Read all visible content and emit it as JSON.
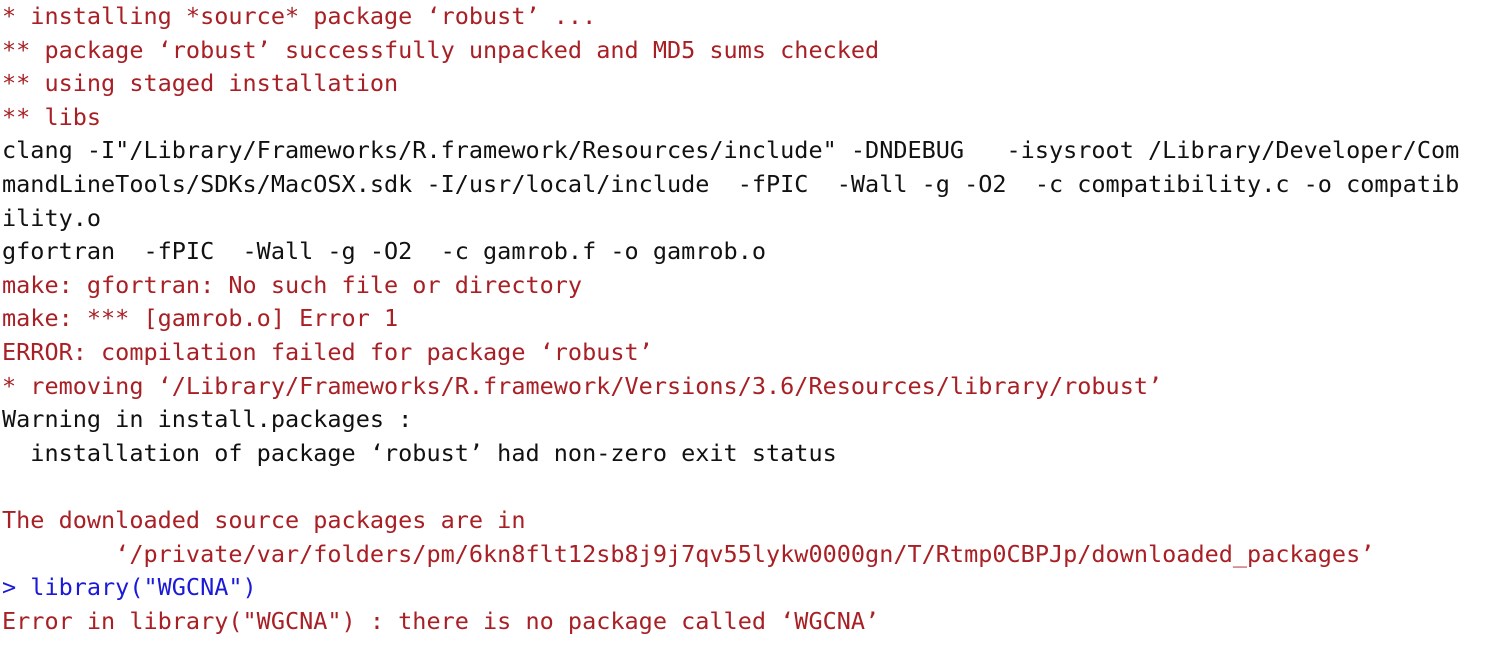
{
  "window": {
    "app": "R Console",
    "background": "#ffffff"
  },
  "colors": {
    "error": "#a82025",
    "stdout": "#111111",
    "prompt": "#1a1ad8"
  },
  "console": {
    "lines": [
      {
        "text": "* installing *source* package ‘robust’ ...",
        "stream": "error"
      },
      {
        "text": "** package ‘robust’ successfully unpacked and MD5 sums checked",
        "stream": "error"
      },
      {
        "text": "** using staged installation",
        "stream": "error"
      },
      {
        "text": "** libs",
        "stream": "error"
      },
      {
        "text": "clang -I\"/Library/Frameworks/R.framework/Resources/include\" -DNDEBUG   -isysroot /Library/Developer/Com",
        "stream": "stdout"
      },
      {
        "text": "mandLineTools/SDKs/MacOSX.sdk -I/usr/local/include  -fPIC  -Wall -g -O2  -c compatibility.c -o compatib",
        "stream": "stdout"
      },
      {
        "text": "ility.o",
        "stream": "stdout"
      },
      {
        "text": "gfortran  -fPIC  -Wall -g -O2  -c gamrob.f -o gamrob.o",
        "stream": "stdout"
      },
      {
        "text": "make: gfortran: No such file or directory",
        "stream": "error"
      },
      {
        "text": "make: *** [gamrob.o] Error 1",
        "stream": "error"
      },
      {
        "text": "ERROR: compilation failed for package ‘robust’",
        "stream": "error"
      },
      {
        "text": "* removing ‘/Library/Frameworks/R.framework/Versions/3.6/Resources/library/robust’",
        "stream": "error"
      },
      {
        "text": "Warning in install.packages :",
        "stream": "stdout"
      },
      {
        "text": "  installation of package ‘robust’ had non-zero exit status",
        "stream": "stdout"
      },
      {
        "text": "",
        "stream": "blank"
      },
      {
        "text": "The downloaded source packages are in",
        "stream": "error"
      },
      {
        "text": "        ‘/private/var/folders/pm/6kn8flt12sb8j9j7qv55lykw0000gn/T/Rtmp0CBPJp/downloaded_packages’",
        "stream": "error"
      },
      {
        "text": "> library(\"WGCNA\")",
        "stream": "prompt"
      },
      {
        "text": "Error in library(\"WGCNA\") : there is no package called ‘WGCNA’",
        "stream": "error"
      }
    ]
  }
}
